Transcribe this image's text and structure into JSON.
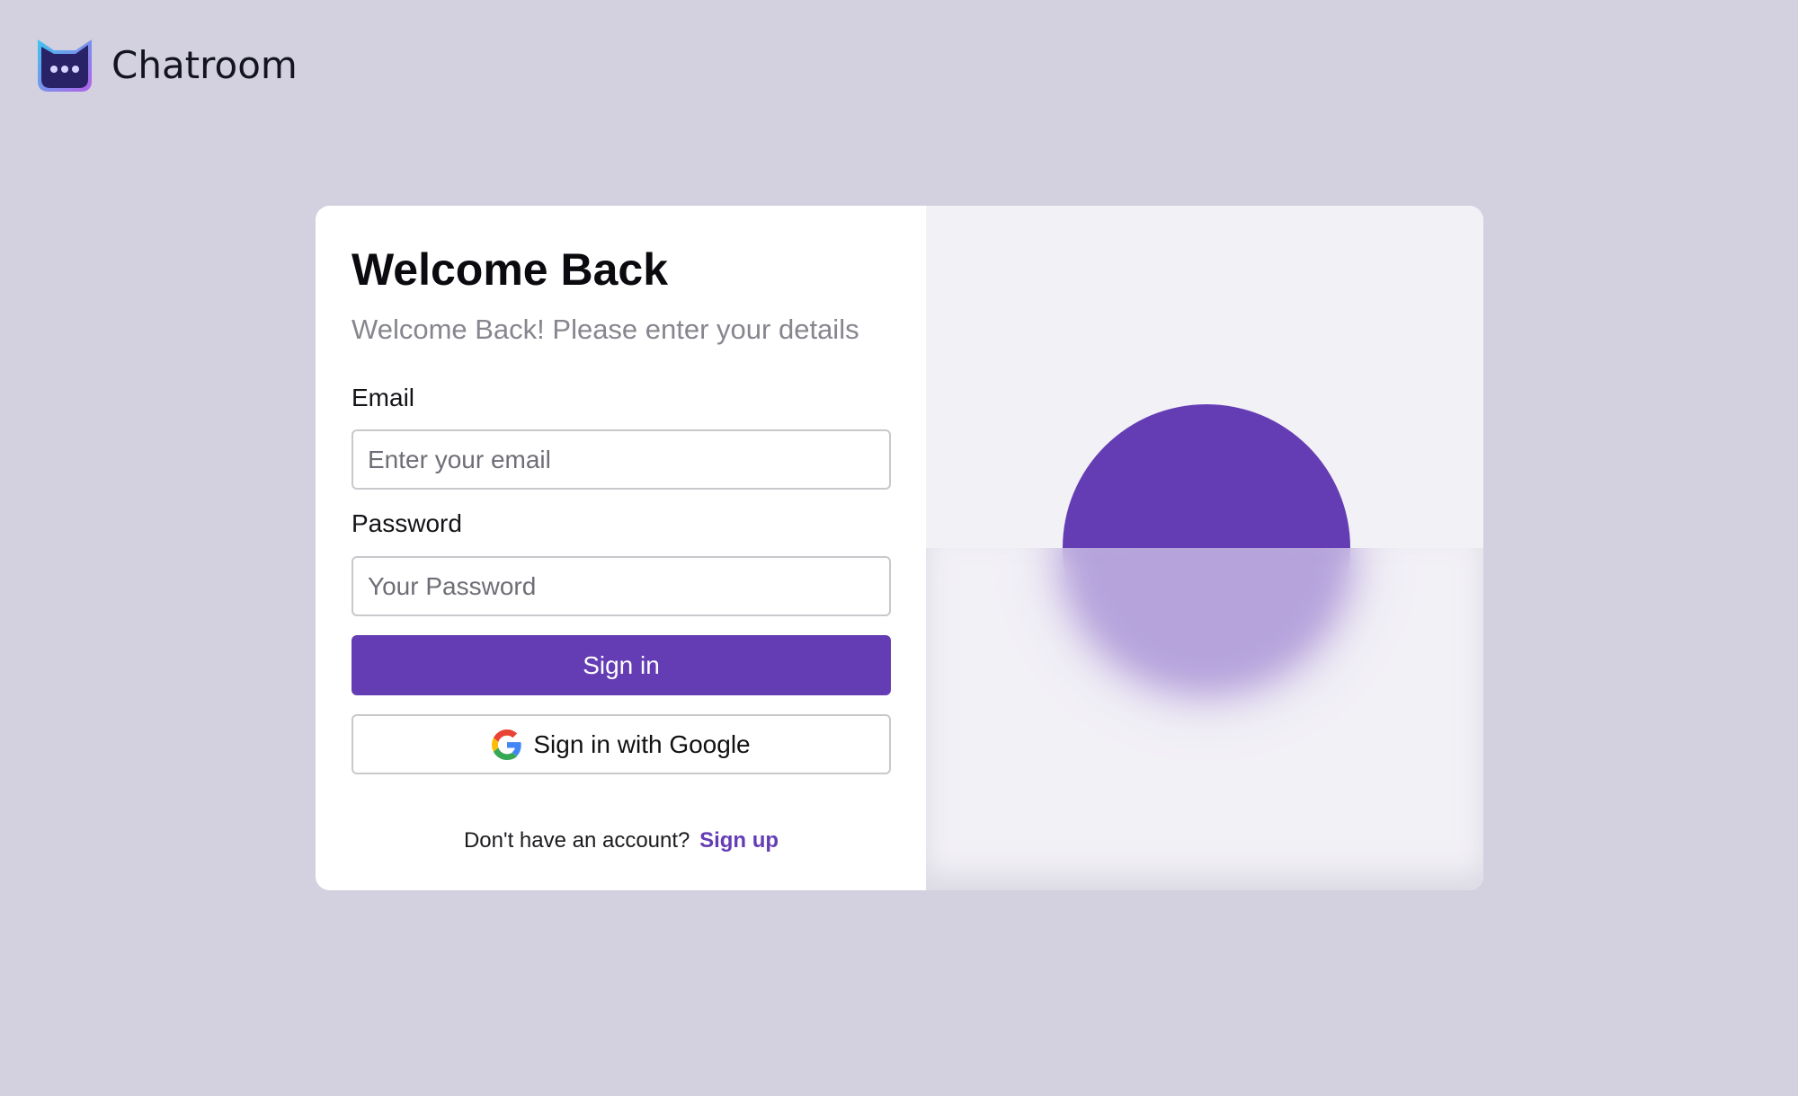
{
  "brand": {
    "name": "Chatroom",
    "logo_icon": "chat-bot-cat-icon"
  },
  "login": {
    "title": "Welcome Back",
    "subtitle": "Welcome Back! Please enter your details",
    "email_label": "Email",
    "email_placeholder": "Enter your email",
    "email_value": "",
    "password_label": "Password",
    "password_placeholder": "Your Password",
    "password_value": "",
    "sign_in_label": "Sign in",
    "google_label": "Sign in with Google",
    "google_icon": "google-icon",
    "no_account_text": "Don't have an account?",
    "sign_up_label": "Sign up"
  },
  "colors": {
    "accent": "#643db4",
    "background": "#d3d1df",
    "panel": "#f2f1f6"
  }
}
